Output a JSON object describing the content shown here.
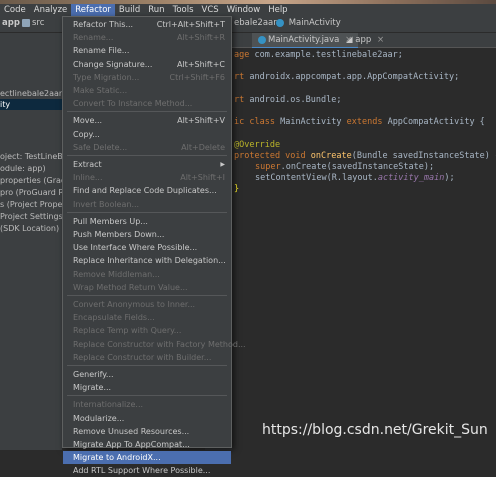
{
  "menubar": {
    "items": [
      "Code",
      "Analyze",
      "Refactor",
      "Build",
      "Run",
      "Tools",
      "VCS",
      "Window",
      "Help"
    ],
    "active": "Refactor"
  },
  "toolbar": {
    "project_label": "app",
    "src_label": "src",
    "file_crumb": "ebale2aar",
    "class_crumb": "MainActivity"
  },
  "tabs": [
    {
      "label": "MainActivity.java",
      "close": "×"
    },
    {
      "label": "app",
      "close": "×"
    }
  ],
  "project_tree": [
    "ectlinebale2aar",
    "ity",
    "oject: TestLineBal",
    "odule: app)",
    "properties (Grad",
    "pro (ProGuard R",
    "s (Project Proper",
    "Project Settings)",
    "(SDK Location)"
  ],
  "code": {
    "line1_kw": "age",
    "line1_rest": " com.example.testlinebale2aar;",
    "line2_kw": "rt",
    "line2_rest": " androidx.appcompat.app.AppCompatActivity;",
    "line3_kw": "rt",
    "line3_rest": " android.os.Bundle;",
    "line4_kw1": "ic",
    "line4_kw2": "class",
    "line4_name": " MainActivity ",
    "line4_kw3": "extends",
    "line4_rest": " AppCompatActivity {",
    "line5": "@Override",
    "line6_kw": "protected void",
    "line6_fn": "onCreate",
    "line6_rest": "(Bundle savedInstanceState) {",
    "line7_kw": "super",
    "line7_rest": ".onCreate(savedInstanceState);",
    "line8_a": "setContentView(R.layout.",
    "line8_it": "activity_main",
    "line8_b": ");",
    "line9": "}"
  },
  "refactor_menu": [
    {
      "label": "Refactor This...",
      "shortcut": "Ctrl+Alt+Shift+T",
      "enabled": true
    },
    {
      "label": "Rename...",
      "shortcut": "Alt+Shift+R",
      "enabled": false
    },
    {
      "label": "Rename File...",
      "shortcut": "",
      "enabled": true
    },
    {
      "label": "Change Signature...",
      "shortcut": "Alt+Shift+C",
      "enabled": true
    },
    {
      "label": "Type Migration...",
      "shortcut": "Ctrl+Shift+F6",
      "enabled": false
    },
    {
      "label": "Make Static...",
      "shortcut": "",
      "enabled": false
    },
    {
      "label": "Convert To Instance Method...",
      "shortcut": "",
      "enabled": false
    },
    {
      "sep": true
    },
    {
      "label": "Move...",
      "shortcut": "Alt+Shift+V",
      "enabled": true
    },
    {
      "label": "Copy...",
      "shortcut": "",
      "enabled": true
    },
    {
      "label": "Safe Delete...",
      "shortcut": "Alt+Delete",
      "enabled": false
    },
    {
      "sep": true
    },
    {
      "label": "Extract",
      "shortcut": "",
      "enabled": true,
      "submenu": true
    },
    {
      "label": "Inline...",
      "shortcut": "Alt+Shift+I",
      "enabled": false
    },
    {
      "label": "Find and Replace Code Duplicates...",
      "shortcut": "",
      "enabled": true
    },
    {
      "label": "Invert Boolean...",
      "shortcut": "",
      "enabled": false
    },
    {
      "sep": true
    },
    {
      "label": "Pull Members Up...",
      "shortcut": "",
      "enabled": true
    },
    {
      "label": "Push Members Down...",
      "shortcut": "",
      "enabled": true
    },
    {
      "label": "Use Interface Where Possible...",
      "shortcut": "",
      "enabled": true
    },
    {
      "label": "Replace Inheritance with Delegation...",
      "shortcut": "",
      "enabled": true
    },
    {
      "label": "Remove Middleman...",
      "shortcut": "",
      "enabled": false
    },
    {
      "label": "Wrap Method Return Value...",
      "shortcut": "",
      "enabled": false
    },
    {
      "sep": true
    },
    {
      "label": "Convert Anonymous to Inner...",
      "shortcut": "",
      "enabled": false
    },
    {
      "label": "Encapsulate Fields...",
      "shortcut": "",
      "enabled": false
    },
    {
      "label": "Replace Temp with Query...",
      "shortcut": "",
      "enabled": false
    },
    {
      "label": "Replace Constructor with Factory Method...",
      "shortcut": "",
      "enabled": false
    },
    {
      "label": "Replace Constructor with Builder...",
      "shortcut": "",
      "enabled": false
    },
    {
      "sep": true
    },
    {
      "label": "Generify...",
      "shortcut": "",
      "enabled": true
    },
    {
      "label": "Migrate...",
      "shortcut": "",
      "enabled": true
    },
    {
      "sep": true
    },
    {
      "label": "Internationalize...",
      "shortcut": "",
      "enabled": false
    },
    {
      "label": "Modularize...",
      "shortcut": "",
      "enabled": true
    },
    {
      "label": "Remove Unused Resources...",
      "shortcut": "",
      "enabled": true
    },
    {
      "label": "Migrate App To AppCompat...",
      "shortcut": "",
      "enabled": true
    },
    {
      "label": "Migrate to AndroidX...",
      "shortcut": "",
      "enabled": true,
      "highlighted": true
    },
    {
      "label": "Add RTL Support Where Possible...",
      "shortcut": "",
      "enabled": true
    }
  ],
  "watermark": "https://blog.csdn.net/Grekit_Sun",
  "colors": {
    "highlight": "#4b6eaf",
    "menu_bg": "#3c3f41",
    "editor_bg": "#2b2b2b",
    "keyword": "#cc7832"
  }
}
